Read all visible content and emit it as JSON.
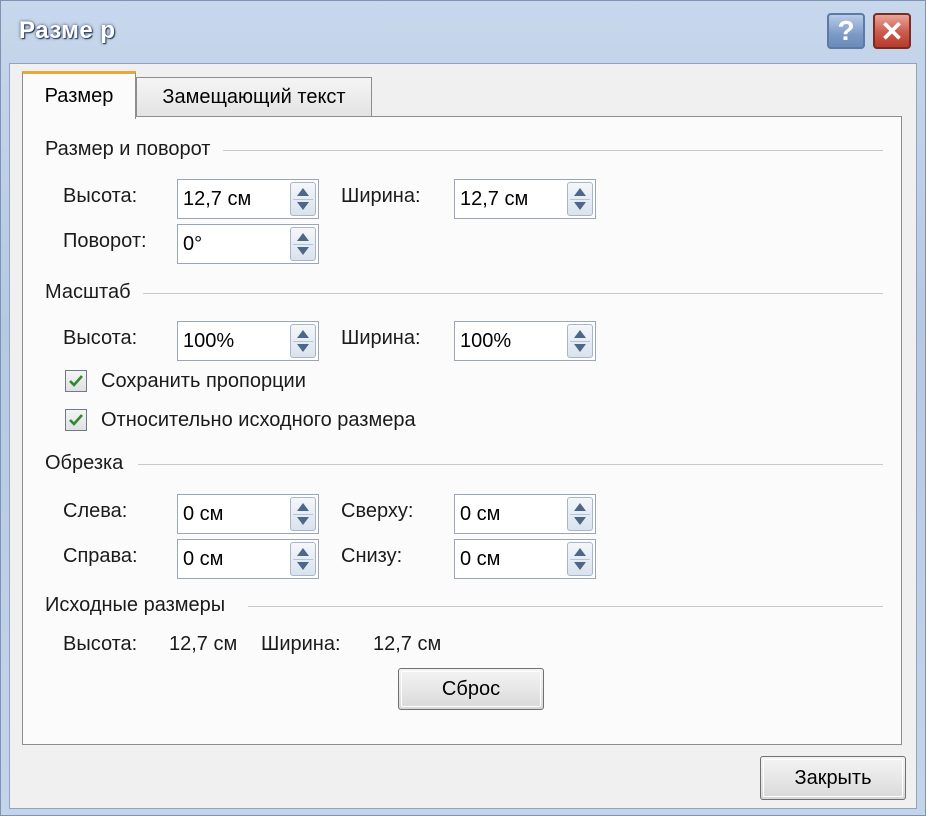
{
  "window": {
    "title": "Разме р",
    "help_label": "?",
    "close_label": "✕"
  },
  "tabs": [
    {
      "label": "Размер",
      "active": true
    },
    {
      "label": "Замещающий текст",
      "active": false
    }
  ],
  "size_rotation": {
    "title": "Размер и поворот",
    "height_label": "Высота:",
    "height_value": "12,7 см",
    "width_label": "Ширина:",
    "width_value": "12,7 см",
    "rotation_label": "Поворот:",
    "rotation_value": "0°"
  },
  "scale": {
    "title": "Масштаб",
    "height_label": "Высота:",
    "height_value": "100%",
    "width_label": "Ширина:",
    "width_value": "100%",
    "lock_aspect_label": "Сохранить пропорции",
    "lock_aspect_checked": true,
    "relative_label": "Относительно исходного размера",
    "relative_checked": true
  },
  "crop": {
    "title": "Обрезка",
    "left_label": "Слева:",
    "left_value": "0 см",
    "top_label": "Сверху:",
    "top_value": "0 см",
    "right_label": "Справа:",
    "right_value": "0 см",
    "bottom_label": "Снизу:",
    "bottom_value": "0 см"
  },
  "original": {
    "title": "Исходные размеры",
    "height_label": "Высота:",
    "height_value": "12,7 см",
    "width_label": "Ширина:",
    "width_value": "12,7 см",
    "reset_label": "Сброс"
  },
  "footer": {
    "close_label": "Закрыть"
  },
  "colors": {
    "title_bar": "#b6c9e2",
    "active_tab_accent": "#e9a73c",
    "close_button": "#cb5a4b",
    "spin_arrow": "#4d6788",
    "check_mark": "#2f8a2f"
  },
  "icons": {
    "help": "help-icon",
    "close": "close-icon",
    "spin_up": "chevron-up-icon",
    "spin_down": "chevron-down-icon",
    "check": "check-icon"
  }
}
